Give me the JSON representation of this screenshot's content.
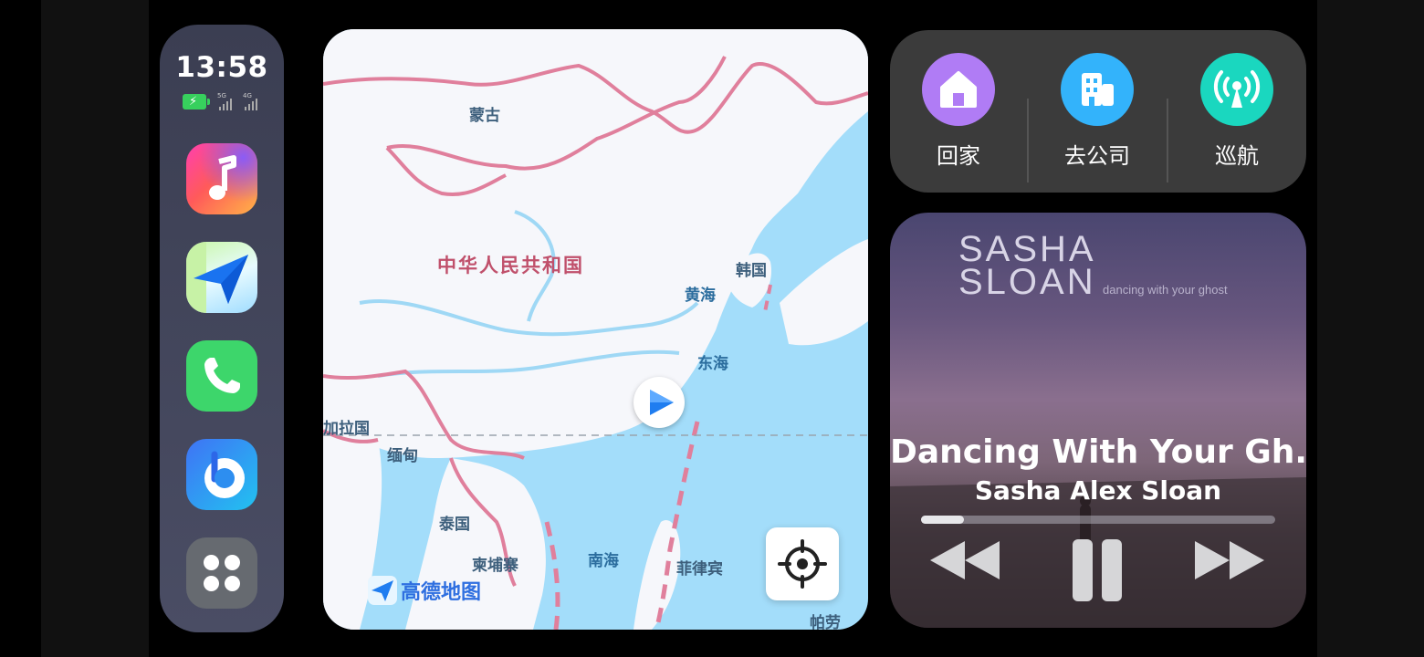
{
  "status_bar": {
    "time": "13:58",
    "battery": {
      "charging": true,
      "color": "#37d05d"
    },
    "signals": [
      {
        "label": "5G",
        "strength": 4
      },
      {
        "label": "4G",
        "strength": 4
      }
    ]
  },
  "dock": {
    "apps": [
      {
        "name": "music",
        "icon": "music-note-icon"
      },
      {
        "name": "navigation",
        "icon": "paper-plane-icon"
      },
      {
        "name": "phone",
        "icon": "phone-handset-icon"
      },
      {
        "name": "assistant",
        "icon": "letter-b-icon"
      },
      {
        "name": "all-apps",
        "icon": "four-dots-icon"
      }
    ]
  },
  "map": {
    "labels": {
      "mongolia": "蒙古",
      "china": "中华人民共和国",
      "korea": "韩国",
      "yellow_sea": "黄海",
      "east_sea": "东海",
      "bangladesh": "加拉国",
      "myanmar": "缅甸",
      "thailand": "泰国",
      "cambodia": "柬埔寨",
      "south_sea": "南海",
      "philippines": "菲律宾",
      "palau": "帕劳"
    },
    "logo_text": "高德地图",
    "locate_icon": "crosshair-locate-icon",
    "position_icon": "navigation-arrow-icon"
  },
  "shortcuts": [
    {
      "label": "回家",
      "icon": "home-icon",
      "color": "#b07cf5"
    },
    {
      "label": "去公司",
      "icon": "office-building-icon",
      "color": "#33b3fb"
    },
    {
      "label": "巡航",
      "icon": "broadcast-tower-icon",
      "color": "#1ad7bf"
    }
  ],
  "now_playing": {
    "art_text": "SASHA\nSLOAN",
    "art_title_line1": "SASHA",
    "art_title_line2": "SLOAN",
    "art_subtitle": "dancing with your ghost",
    "title": "Dancing With Your Gh...",
    "artist": "Sasha Alex Sloan",
    "progress": 0.12,
    "controls": [
      "rewind-icon",
      "pause-icon",
      "fast-forward-icon"
    ]
  }
}
